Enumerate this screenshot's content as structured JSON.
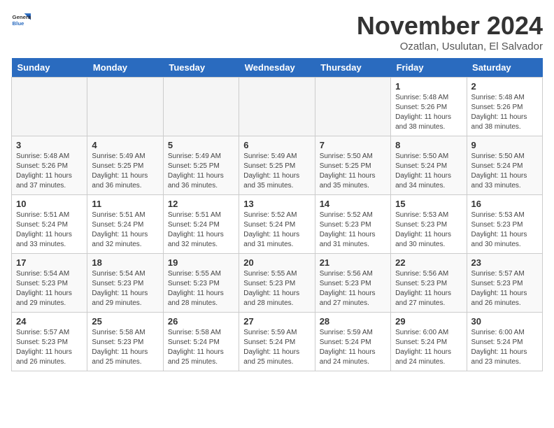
{
  "logo": {
    "line1": "General",
    "line2": "Blue"
  },
  "title": "November 2024",
  "location": "Ozatlan, Usulutan, El Salvador",
  "weekdays": [
    "Sunday",
    "Monday",
    "Tuesday",
    "Wednesday",
    "Thursday",
    "Friday",
    "Saturday"
  ],
  "weeks": [
    [
      {
        "day": "",
        "detail": ""
      },
      {
        "day": "",
        "detail": ""
      },
      {
        "day": "",
        "detail": ""
      },
      {
        "day": "",
        "detail": ""
      },
      {
        "day": "",
        "detail": ""
      },
      {
        "day": "1",
        "detail": "Sunrise: 5:48 AM\nSunset: 5:26 PM\nDaylight: 11 hours\nand 38 minutes."
      },
      {
        "day": "2",
        "detail": "Sunrise: 5:48 AM\nSunset: 5:26 PM\nDaylight: 11 hours\nand 38 minutes."
      }
    ],
    [
      {
        "day": "3",
        "detail": "Sunrise: 5:48 AM\nSunset: 5:26 PM\nDaylight: 11 hours\nand 37 minutes."
      },
      {
        "day": "4",
        "detail": "Sunrise: 5:49 AM\nSunset: 5:25 PM\nDaylight: 11 hours\nand 36 minutes."
      },
      {
        "day": "5",
        "detail": "Sunrise: 5:49 AM\nSunset: 5:25 PM\nDaylight: 11 hours\nand 36 minutes."
      },
      {
        "day": "6",
        "detail": "Sunrise: 5:49 AM\nSunset: 5:25 PM\nDaylight: 11 hours\nand 35 minutes."
      },
      {
        "day": "7",
        "detail": "Sunrise: 5:50 AM\nSunset: 5:25 PM\nDaylight: 11 hours\nand 35 minutes."
      },
      {
        "day": "8",
        "detail": "Sunrise: 5:50 AM\nSunset: 5:24 PM\nDaylight: 11 hours\nand 34 minutes."
      },
      {
        "day": "9",
        "detail": "Sunrise: 5:50 AM\nSunset: 5:24 PM\nDaylight: 11 hours\nand 33 minutes."
      }
    ],
    [
      {
        "day": "10",
        "detail": "Sunrise: 5:51 AM\nSunset: 5:24 PM\nDaylight: 11 hours\nand 33 minutes."
      },
      {
        "day": "11",
        "detail": "Sunrise: 5:51 AM\nSunset: 5:24 PM\nDaylight: 11 hours\nand 32 minutes."
      },
      {
        "day": "12",
        "detail": "Sunrise: 5:51 AM\nSunset: 5:24 PM\nDaylight: 11 hours\nand 32 minutes."
      },
      {
        "day": "13",
        "detail": "Sunrise: 5:52 AM\nSunset: 5:24 PM\nDaylight: 11 hours\nand 31 minutes."
      },
      {
        "day": "14",
        "detail": "Sunrise: 5:52 AM\nSunset: 5:23 PM\nDaylight: 11 hours\nand 31 minutes."
      },
      {
        "day": "15",
        "detail": "Sunrise: 5:53 AM\nSunset: 5:23 PM\nDaylight: 11 hours\nand 30 minutes."
      },
      {
        "day": "16",
        "detail": "Sunrise: 5:53 AM\nSunset: 5:23 PM\nDaylight: 11 hours\nand 30 minutes."
      }
    ],
    [
      {
        "day": "17",
        "detail": "Sunrise: 5:54 AM\nSunset: 5:23 PM\nDaylight: 11 hours\nand 29 minutes."
      },
      {
        "day": "18",
        "detail": "Sunrise: 5:54 AM\nSunset: 5:23 PM\nDaylight: 11 hours\nand 29 minutes."
      },
      {
        "day": "19",
        "detail": "Sunrise: 5:55 AM\nSunset: 5:23 PM\nDaylight: 11 hours\nand 28 minutes."
      },
      {
        "day": "20",
        "detail": "Sunrise: 5:55 AM\nSunset: 5:23 PM\nDaylight: 11 hours\nand 28 minutes."
      },
      {
        "day": "21",
        "detail": "Sunrise: 5:56 AM\nSunset: 5:23 PM\nDaylight: 11 hours\nand 27 minutes."
      },
      {
        "day": "22",
        "detail": "Sunrise: 5:56 AM\nSunset: 5:23 PM\nDaylight: 11 hours\nand 27 minutes."
      },
      {
        "day": "23",
        "detail": "Sunrise: 5:57 AM\nSunset: 5:23 PM\nDaylight: 11 hours\nand 26 minutes."
      }
    ],
    [
      {
        "day": "24",
        "detail": "Sunrise: 5:57 AM\nSunset: 5:23 PM\nDaylight: 11 hours\nand 26 minutes."
      },
      {
        "day": "25",
        "detail": "Sunrise: 5:58 AM\nSunset: 5:23 PM\nDaylight: 11 hours\nand 25 minutes."
      },
      {
        "day": "26",
        "detail": "Sunrise: 5:58 AM\nSunset: 5:24 PM\nDaylight: 11 hours\nand 25 minutes."
      },
      {
        "day": "27",
        "detail": "Sunrise: 5:59 AM\nSunset: 5:24 PM\nDaylight: 11 hours\nand 25 minutes."
      },
      {
        "day": "28",
        "detail": "Sunrise: 5:59 AM\nSunset: 5:24 PM\nDaylight: 11 hours\nand 24 minutes."
      },
      {
        "day": "29",
        "detail": "Sunrise: 6:00 AM\nSunset: 5:24 PM\nDaylight: 11 hours\nand 24 minutes."
      },
      {
        "day": "30",
        "detail": "Sunrise: 6:00 AM\nSunset: 5:24 PM\nDaylight: 11 hours\nand 23 minutes."
      }
    ]
  ]
}
